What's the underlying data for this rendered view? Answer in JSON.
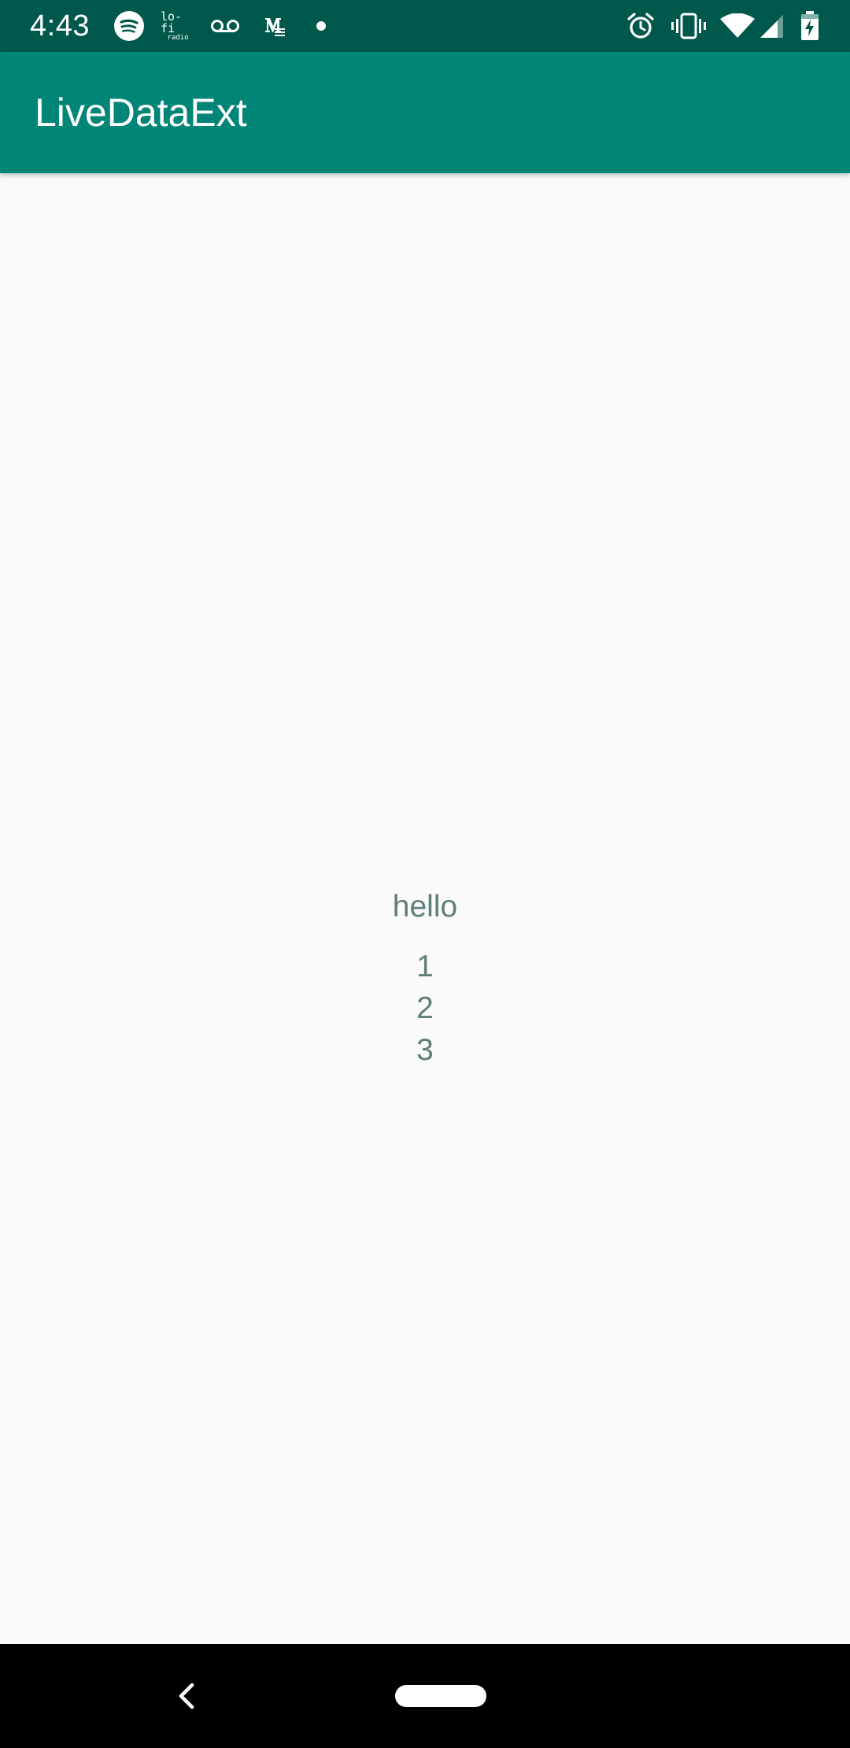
{
  "status_bar": {
    "time": "4:43",
    "lofi_line1": "lo-fi",
    "lofi_line2": "radio",
    "left_icons": [
      "spotify-icon",
      "lofi-radio-icon",
      "voicemail-icon",
      "gmail-icon",
      "dot-icon"
    ],
    "right_icons": [
      "alarm-icon",
      "vibrate-icon",
      "wifi-icon",
      "cell-signal-icon",
      "battery-charging-icon"
    ],
    "background": "#00574b"
  },
  "app_bar": {
    "title": "LiveDataExt",
    "background": "#008577"
  },
  "main": {
    "hello": "hello",
    "items": [
      "1",
      "2",
      "3"
    ],
    "text_color": "#5f7f7b"
  },
  "nav_bar": {
    "icons": [
      "back-icon",
      "home-pill-icon"
    ]
  }
}
